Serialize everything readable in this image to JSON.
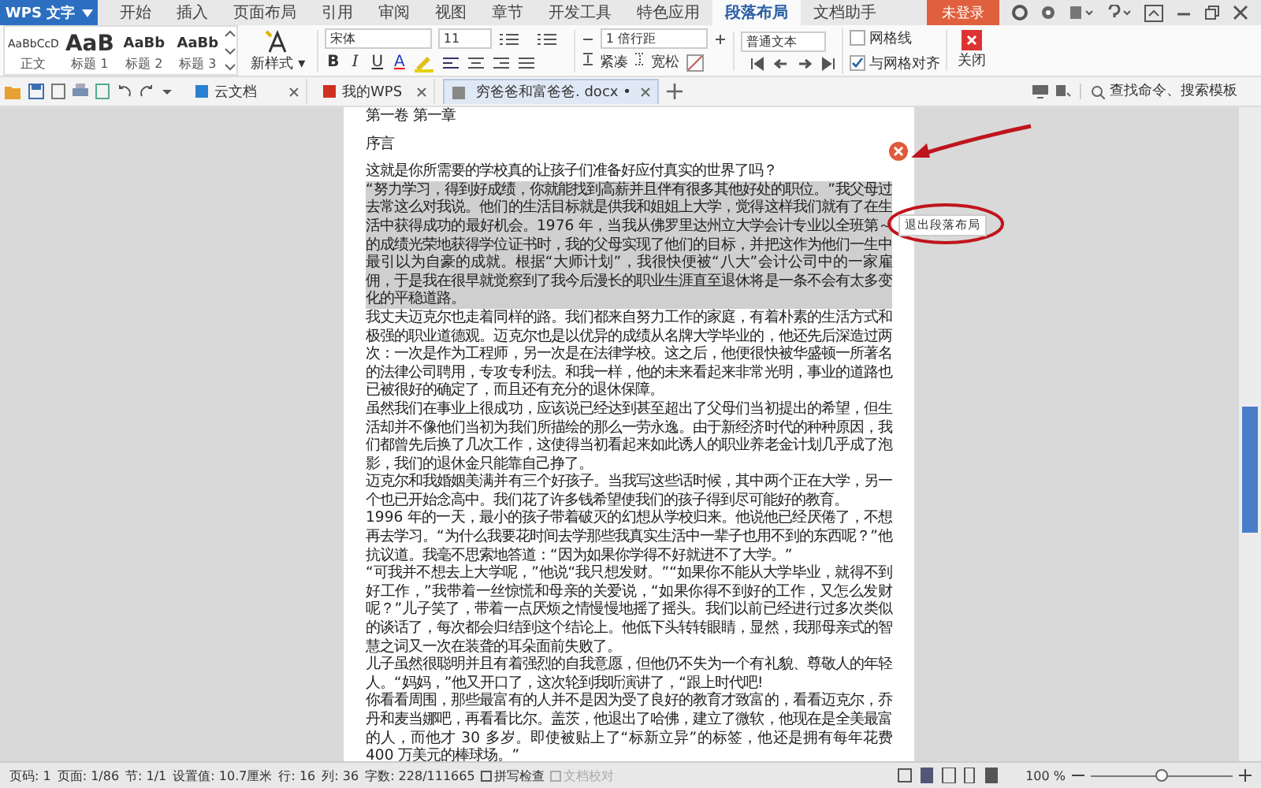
{
  "app_button": {
    "label": "WPS 文字"
  },
  "menu_tabs": [
    {
      "label": "开始",
      "selected": false
    },
    {
      "label": "插入",
      "selected": false
    },
    {
      "label": "页面布局",
      "selected": false
    },
    {
      "label": "引用",
      "selected": false
    },
    {
      "label": "审阅",
      "selected": false
    },
    {
      "label": "视图",
      "selected": false
    },
    {
      "label": "章节",
      "selected": false
    },
    {
      "label": "开发工具",
      "selected": false
    },
    {
      "label": "特色应用",
      "selected": false
    },
    {
      "label": "段落布局",
      "selected": true
    },
    {
      "label": "文档助手",
      "selected": false
    }
  ],
  "login_button": "未登录",
  "ribbon": {
    "styles": [
      {
        "preview": "AaBbCcD",
        "name": "正文",
        "kind": "small"
      },
      {
        "preview": "AaB",
        "name": "标题 1",
        "kind": "big"
      },
      {
        "preview": "AaBb",
        "name": "标题 2",
        "kind": "mid"
      },
      {
        "preview": "AaBb",
        "name": "标题 3",
        "kind": "mid"
      }
    ],
    "new_style": "新样式 ▾",
    "format_buttons": [
      "B",
      "I",
      "U",
      "A"
    ],
    "font": "宋体",
    "font_size": "11",
    "compact": "紧凑",
    "loose": "宽松",
    "line_spacing": "1 倍行距",
    "text_level": "普通文本",
    "checkboxes": [
      {
        "label": "网格线",
        "checked": false
      },
      {
        "label": "与网格对齐",
        "checked": true
      }
    ],
    "close": "关闭"
  },
  "doc_tabs": [
    {
      "label": "云文档",
      "selected": false
    },
    {
      "label": "我的WPS",
      "selected": false
    },
    {
      "label": "穷爸爸和富爸爸. docx •",
      "selected": true
    }
  ],
  "search": {
    "placeholder": "查找命令、搜索模板"
  },
  "document": {
    "heading": "第一卷 第一章",
    "subheading": "序言",
    "paragraphs": [
      {
        "text": "这就是你所需要的学校真的让孩子们准备好应付真实的世界了吗？",
        "highlighted": false
      },
      {
        "text": "“努力学习，得到好成绩，你就能找到高薪并且伴有很多其他好处的职位。”我父母过去常这么对我说。他们的生活目标就是供我和姐姐上大学，觉得这样我们就有了在生活中获得成功的最好机会。1976 年，当我从佛罗里达州立大学会计专业以全班第～的成绩光荣地获得学位证书时，我的父母实现了他们的目标，并把这作为他们一生中最引以为自豪的成就。根据“大师计划”，我很快便被“八大”会计公司中的一家雇佣，于是我在很早就觉察到了我今后漫长的职业生涯直至退休将是一条不会有太多变化的平稳道路。",
        "highlighted": true
      },
      {
        "text": "我丈夫迈克尔也走着同样的路。我们都来自努力工作的家庭，有着朴素的生活方式和极强的职业道德观。迈克尔也是以优异的成绩从名牌大学毕业的，他还先后深造过两次：一次是作为工程师，另一次是在法律学校。这之后，他便很快被华盛顿一所著名的法律公司聘用，专攻专利法。和我一样，他的未来看起来非常光明，事业的道路也已被很好的确定了，而且还有充分的退休保障。",
        "highlighted": false
      },
      {
        "text": "虽然我们在事业上很成功，应该说已经达到甚至超出了父母们当初提出的希望，但生活却并不像他们当初为我们所描绘的那么一劳永逸。由于新经济时代的种种原因，我们都曾先后换了几次工作，这使得当初看起来如此诱人的职业养老金计划几乎成了泡影，我们的退休金只能靠自己挣了。",
        "highlighted": false
      },
      {
        "text": "迈克尔和我婚姻美满并有三个好孩子。当我写这些话时候，其中两个正在大学，另一个也已开始念高中。我们花了许多钱希望使我们的孩子得到尽可能好的教育。",
        "highlighted": false
      },
      {
        "text": "1996 年的一天，最小的孩子带着破灭的幻想从学校归来。他说他已经厌倦了，不想再去学习。“为什么我要花时间去学那些我真实生活中一辈子也用不到的东西呢？”他抗议道。我毫不思索地答道：“因为如果你学得不好就进不了大学。”",
        "highlighted": false
      },
      {
        "text": "“可我并不想去上大学呢，”他说“我只想发财。”“如果你不能从大学毕业，就得不到好工作，”我带着一丝惊慌和母亲的关爱说，“如果你得不到好的工作，又怎么发财呢？”儿子笑了，带着一点厌烦之情慢慢地摇了摇头。我们以前已经进行过多次类似的谈话了，每次都会归结到这个结论上。他低下头转转眼睛，显然，我那母亲式的智慧之词又一次在装聋的耳朵面前失败了。",
        "highlighted": false
      },
      {
        "text": "儿子虽然很聪明并且有着强烈的自我意愿，但他仍不失为一个有礼貌、尊敬人的年轻人。“妈妈，”他又开口了，这次轮到我听演讲了，“跟上时代吧!",
        "highlighted": false
      },
      {
        "text": "你看看周围，那些最富有的人并不是因为受了良好的教育才致富的，看看迈克尔，乔丹和麦当娜吧，再看看比尔。盖茨，他退出了哈佛，建立了微软，他现在是全美最富的人，而他才 30 多岁。即使被贴上了“标新立异”的标签，他还是拥有每年花费 400 万美元的棒球场。”",
        "highlighted": false
      }
    ],
    "exit_button": "退出段落布局"
  },
  "status_bar": [
    "页码: 1",
    "页面: 1/86",
    "节: 1/1",
    "设置值: 10.7厘米",
    "行: 16",
    "列: 36",
    "字数: 228/111665"
  ],
  "status_checks": [
    {
      "label": "拼写检查",
      "disabled": false
    },
    {
      "label": "文档校对",
      "disabled": true
    }
  ],
  "zoom": {
    "reading": "100 %",
    "level": 0.5
  }
}
